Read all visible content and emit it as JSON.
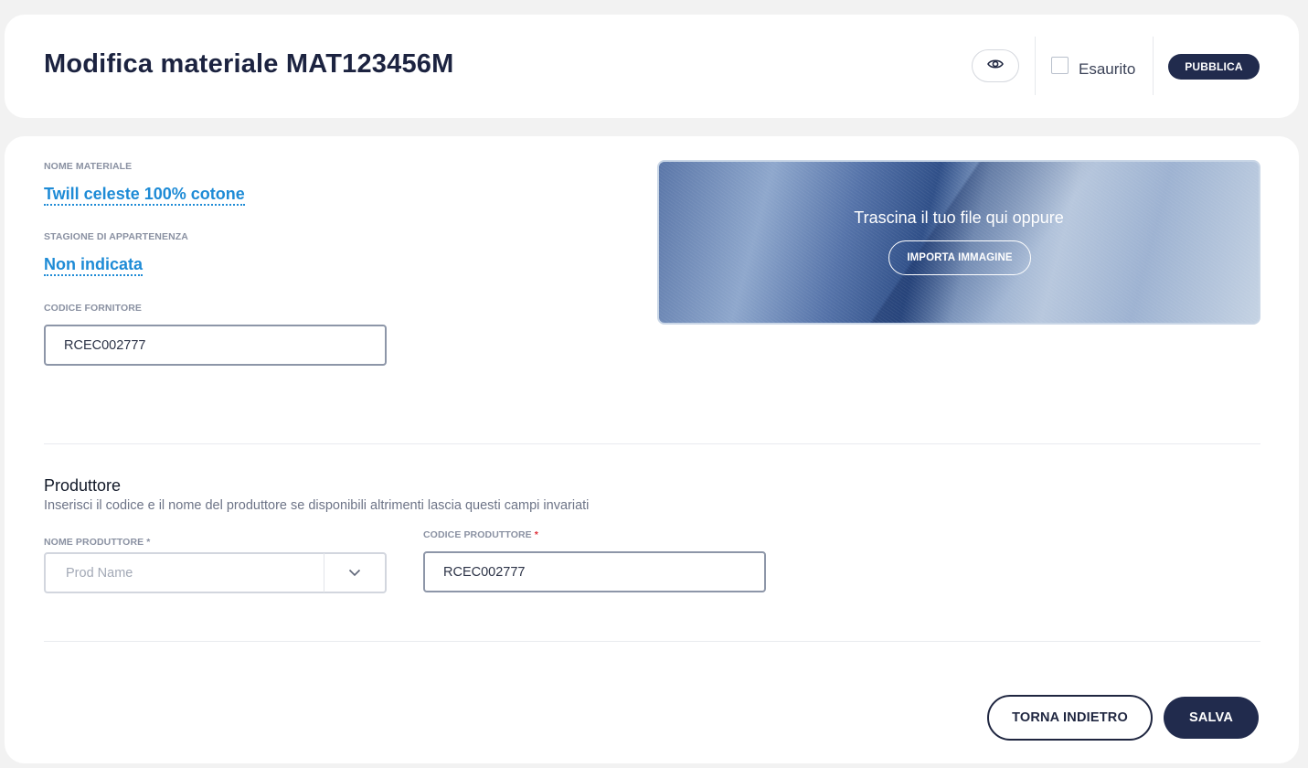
{
  "header": {
    "title": "Modifica materiale MAT123456M",
    "preview_icon": "eye-icon",
    "sold_out_label": "Esaurito",
    "sold_out_checked": false,
    "publish_label": "PUBBLICA"
  },
  "material": {
    "name_label": "NOME MATERIALE",
    "name_value": "Twill celeste 100% cotone",
    "season_label": "STAGIONE DI APPARTENENZA",
    "season_value": "Non indicata",
    "supplier_code_label": "CODICE FORNITORE",
    "supplier_code_value": "RCEC002777"
  },
  "image_upload": {
    "drop_text": "Trascina il tuo file qui oppure",
    "import_label": "IMPORTA IMMAGINE"
  },
  "producer": {
    "section_title": "Produttore",
    "section_subtitle": "Inserisci il codice e il nome del produttore se disponibili altrimenti lascia questi campi invariati",
    "name_label": "NOME PRODUTTORE *",
    "name_placeholder": "Prod Name",
    "code_label": "CODICE PRODUTTORE",
    "code_required_mark": "*",
    "code_value": "RCEC002777"
  },
  "footer": {
    "back_label": "TORNA INDIETRO",
    "save_label": "SALVA"
  },
  "colors": {
    "primary": "#212b4d",
    "link": "#1e8bd6",
    "required": "#e0313a",
    "background": "#f2f2f2"
  }
}
